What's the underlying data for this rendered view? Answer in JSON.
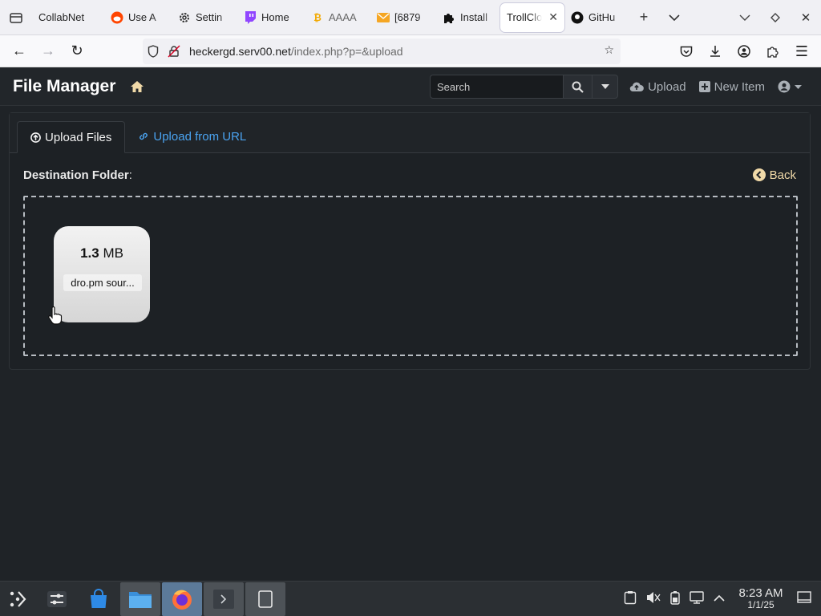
{
  "browser": {
    "tabs": [
      {
        "label": "CollabNet",
        "icon": "none"
      },
      {
        "label": "Use A",
        "icon": "reddit-icon"
      },
      {
        "label": "Settin",
        "icon": "gear-icon"
      },
      {
        "label": "Home",
        "icon": "twitch-icon"
      },
      {
        "label": "AAAA",
        "icon": "bitcoin-icon"
      },
      {
        "label": "[6879",
        "icon": "mail-icon"
      },
      {
        "label": "Install",
        "icon": "puzzle-icon"
      },
      {
        "label": "TrollClo",
        "icon": "none",
        "active": true
      },
      {
        "label": "GitHu",
        "icon": "github-icon"
      }
    ],
    "url_domain": "heckergd.serv00.net",
    "url_path": "/index.php?p=&upload"
  },
  "app": {
    "title": "File Manager",
    "search_placeholder": "Search",
    "nav": {
      "upload_label": "Upload",
      "new_item_label": "New Item"
    }
  },
  "upload": {
    "tabs": {
      "files_label": "Upload Files",
      "url_label": "Upload from URL"
    },
    "destination_label": "Destination Folder",
    "destination_suffix": ":",
    "back_label": "Back",
    "file": {
      "size_value": "1.3",
      "size_unit": "MB",
      "name": "dro.pm sour..."
    }
  },
  "taskbar": {
    "time": "8:23 AM",
    "date": "1/1/25"
  },
  "colors": {
    "accent_link": "#4aa3f0",
    "accent_warm": "#f0d9a8",
    "page_bg": "#1f2327"
  }
}
